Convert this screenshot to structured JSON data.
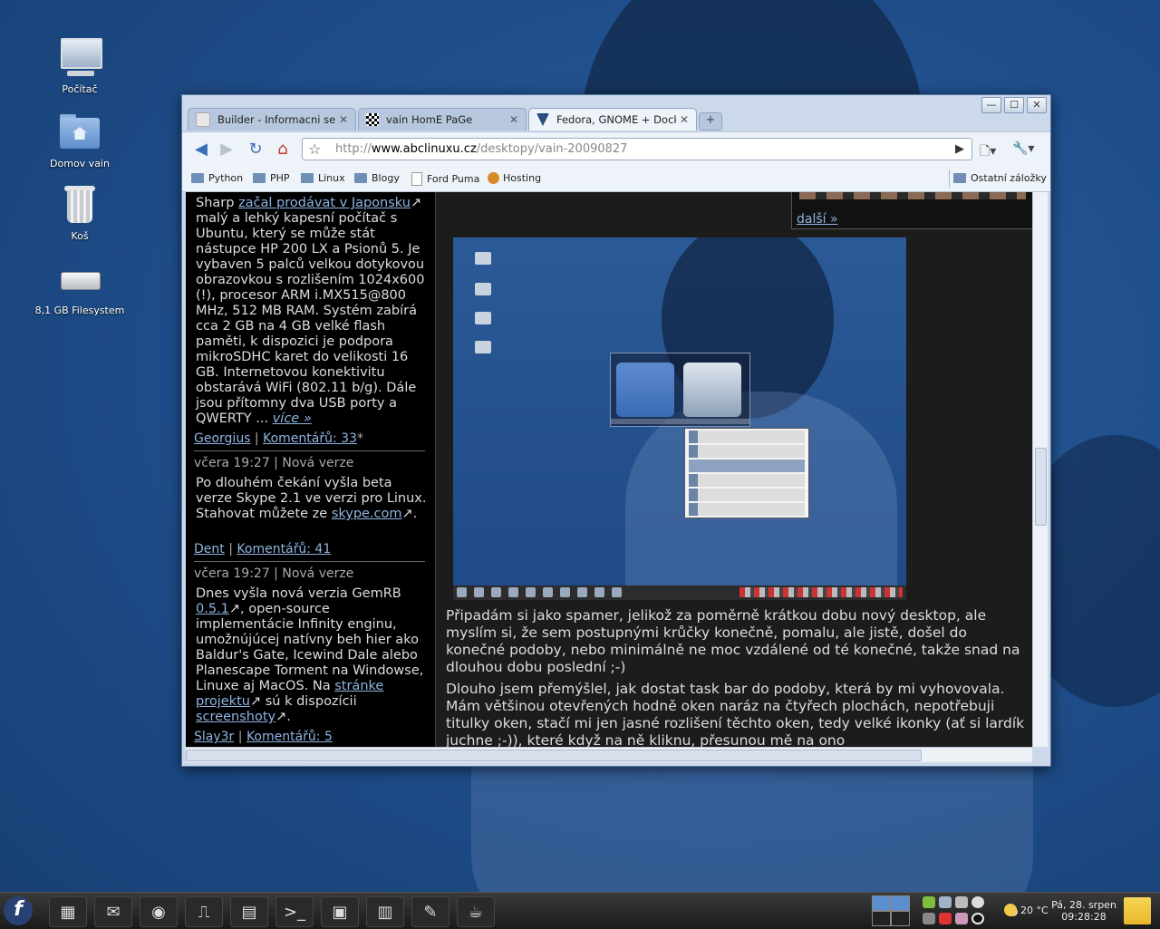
{
  "desktop": {
    "icons": [
      {
        "label": "Počítač"
      },
      {
        "label": "Domov vain"
      },
      {
        "label": "Koš"
      },
      {
        "label": "8,1 GB Filesystem"
      }
    ]
  },
  "browser": {
    "tabs": [
      {
        "title": "Builder - Informacni ser...",
        "close": "✕"
      },
      {
        "title": "vain HomE PaGe",
        "close": "✕"
      },
      {
        "title": "Fedora, GNOME + Dockb...",
        "close": "✕"
      }
    ],
    "new_tab": "+",
    "window_buttons": {
      "minimize": "—",
      "maximize": "☐",
      "close": "✕"
    },
    "url_prefix": "http://",
    "url_domain": "www.abclinuxu.cz",
    "url_path": "/desktopy/vain-20090827",
    "bookmarks": [
      {
        "label": "Python"
      },
      {
        "label": "PHP"
      },
      {
        "label": "Linux"
      },
      {
        "label": "Blogy"
      },
      {
        "label": "Ford Puma"
      },
      {
        "label": "Hosting"
      }
    ],
    "other_bookmarks": "Ostatní záložky"
  },
  "page": {
    "news": [
      {
        "t1": "Sharp ",
        "link1": "začal prodávat v Japonsku",
        "t2": "↗ malý a lehký kapesní počítač s Ubuntu, který se může stát nástupce HP 200 LX a Psionů 5. Je vybaven 5 palců velkou dotykovou obrazovkou s rozlišením 1024x600 (!), procesor ARM i.MX515@800 MHz, 512 MB RAM. Systém zabírá cca 2 GB na 4 GB velké flash paměti, k dispozici je podpora mikroSDHC karet do velikosti 16 GB. Internetovou konektivitu obstarává WiFi (802.11 b/g). Dále jsou přítomny dva USB porty a QWERTY ... ",
        "more": "více »",
        "author": "Georgius",
        "comments": "Komentářů: 33",
        "mark": "*"
      },
      {
        "meta": "včera 19:27 | Nová verze",
        "t1": "Po dlouhém čekání vyšla beta verze Skype 2.1 ve verzi pro Linux. Stahovat můžete ze ",
        "link1": "skype.com",
        "t2": "↗.",
        "author": "Dent",
        "comments": "Komentářů: 41"
      },
      {
        "meta": "včera 19:27 | Nová verze",
        "t1": "Dnes vyšla nová verzia GemRB ",
        "link1": "0.5.1",
        "t2": "↗, open-source implementácie Infinity enginu, umožnújúcej natívny beh hier ako Baldur's Gate, Icewind Dale alebo Planescape Torment na Windowse, Linuxe aj MacOS. Na ",
        "link2": "stránke projektu",
        "t3": "↗ sú k dispozícii ",
        "link3": "screenshoty",
        "t4": "↗.",
        "author": "Slay3r",
        "comments": "Komentářů: 5"
      }
    ],
    "more_users": "další »",
    "article_p1": "Připadám si jako spamer, jelikož za poměrně krátkou dobu nový desktop, ale myslím si, že sem postupnými krůčky konečně, pomalu, ale jistě, došel do konečné podoby, nebo minimálně ne moc vzdálené od té konečné, takže snad na dlouhou dobu poslední ;-)",
    "article_p2": "Dlouho jsem přemýšlel, jak dostat task bar do podoby, která by mi vyhovovala. Mám většinou otevřených hodně oken naráz na čtyřech plochách, nepotřebuji titulky oken, stačí mi jen jasné rozlišení těchto oken, tedy velké ikonky (ať si lardík juchne ;-)), které když na ně kliknu, přesunou mě na ono"
  },
  "taskbar": {
    "launcher": "f",
    "weather": "20 °C",
    "clock_date": "Pá, 28. srpen",
    "clock_time": "09:28:28"
  },
  "colors": {
    "desktop_bg": "#1f4f8c",
    "link": "#8fb4e0",
    "page_bg": "#000000"
  }
}
